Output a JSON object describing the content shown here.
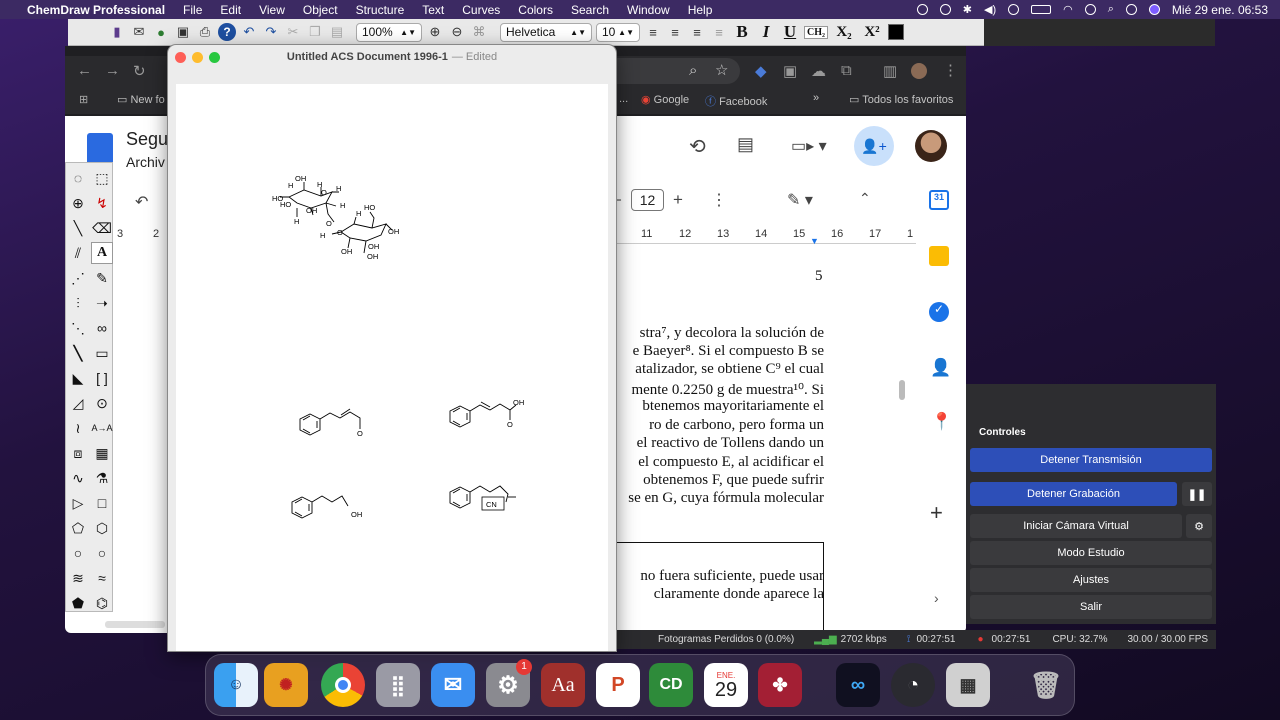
{
  "menubar": {
    "app_name": "ChemDraw Professional",
    "items": [
      "File",
      "Edit",
      "View",
      "Object",
      "Structure",
      "Text",
      "Curves",
      "Colors",
      "Search",
      "Window",
      "Help"
    ],
    "datetime": "Mié 29 ene.  06:53"
  },
  "cd_toolbar": {
    "zoom": "100%",
    "font": "Helvetica",
    "size": "10",
    "fmt_bold": "B",
    "fmt_italic": "I",
    "fmt_underline": "U",
    "fmt_formula": "CH₂",
    "fmt_sub": "X₂",
    "fmt_sup": "X²"
  },
  "chemdraw_window": {
    "title": "Untitled ACS Document 1996-1",
    "status": "— Edited"
  },
  "browser": {
    "bookmarks": {
      "first": "New fo",
      "dots": "...",
      "google": "Google",
      "facebook": "Facebook",
      "more": "»",
      "all": "Todos los favoritos"
    },
    "doc_title": "Segu",
    "doc_menu": "Archiv",
    "font_size": "12",
    "ruler_left": [
      "3",
      "2"
    ],
    "ruler_right": [
      "11",
      "12",
      "13",
      "14",
      "15",
      "16",
      "17",
      "1"
    ],
    "page_number": "5",
    "paragraph": [
      "stra⁷, y decolora la solución de",
      "e Baeyer⁸.  Si el compuesto B se",
      "atalizador, se obtiene C⁹ el cual",
      "mente 0.2250 g de muestra¹⁰.  Si",
      "btenemos mayoritariamente el",
      "ro de carbono, pero forma un",
      "el reactivo de Tollens dando un",
      "el compuesto E, al acidificar el",
      "obtenemos F, que puede sufrir",
      "se en G, cuya fórmula molecular"
    ],
    "box_text": [
      "no fuera suficiente, puede usar",
      "claramente donde aparece la"
    ]
  },
  "obs": {
    "header": "Controles",
    "buttons": [
      "Detener Transmisión",
      "Detener Grabación",
      "Iniciar Cámara Virtual",
      "Modo Estudio",
      "Ajustes",
      "Salir"
    ],
    "status": {
      "frames": "Fotogramas Perdidos 0 (0.0%)",
      "kbps": "2702 kbps",
      "time1": "00:27:51",
      "time2": "00:27:51",
      "cpu": "CPU: 32.7%",
      "fps": "30.00 / 30.00 FPS"
    }
  },
  "chem_labels": {
    "oh": "OH",
    "ho": "HO",
    "h": "H",
    "o": "O",
    "cn": "CN"
  },
  "dock": {
    "calendar_month": "ENE.",
    "calendar_day": "29",
    "mail_badge": "1",
    "dictionary": "Aa",
    "chemdraw": "CD"
  }
}
